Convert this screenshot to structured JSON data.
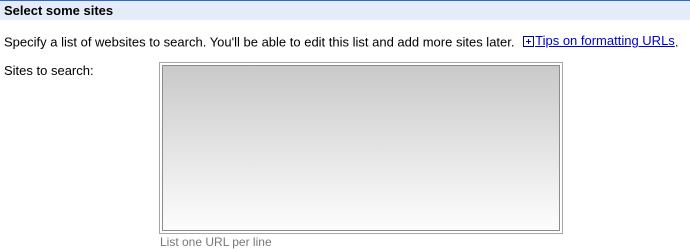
{
  "section": {
    "title": "Select some sites"
  },
  "intro": {
    "text": "Specify a list of websites to search. You'll be able to edit this list and add more sites later.",
    "tips_icon": "plus-box-icon",
    "tips_link_label": "Tips on formatting URLs",
    "trailing": "."
  },
  "sites_field": {
    "label": "Sites to search:",
    "value": "",
    "hint": "List one URL per line"
  },
  "colors": {
    "header_background": "#e5ecf9",
    "header_border": "#3366cc",
    "link": "#0000cc",
    "hint_text": "#777777"
  }
}
